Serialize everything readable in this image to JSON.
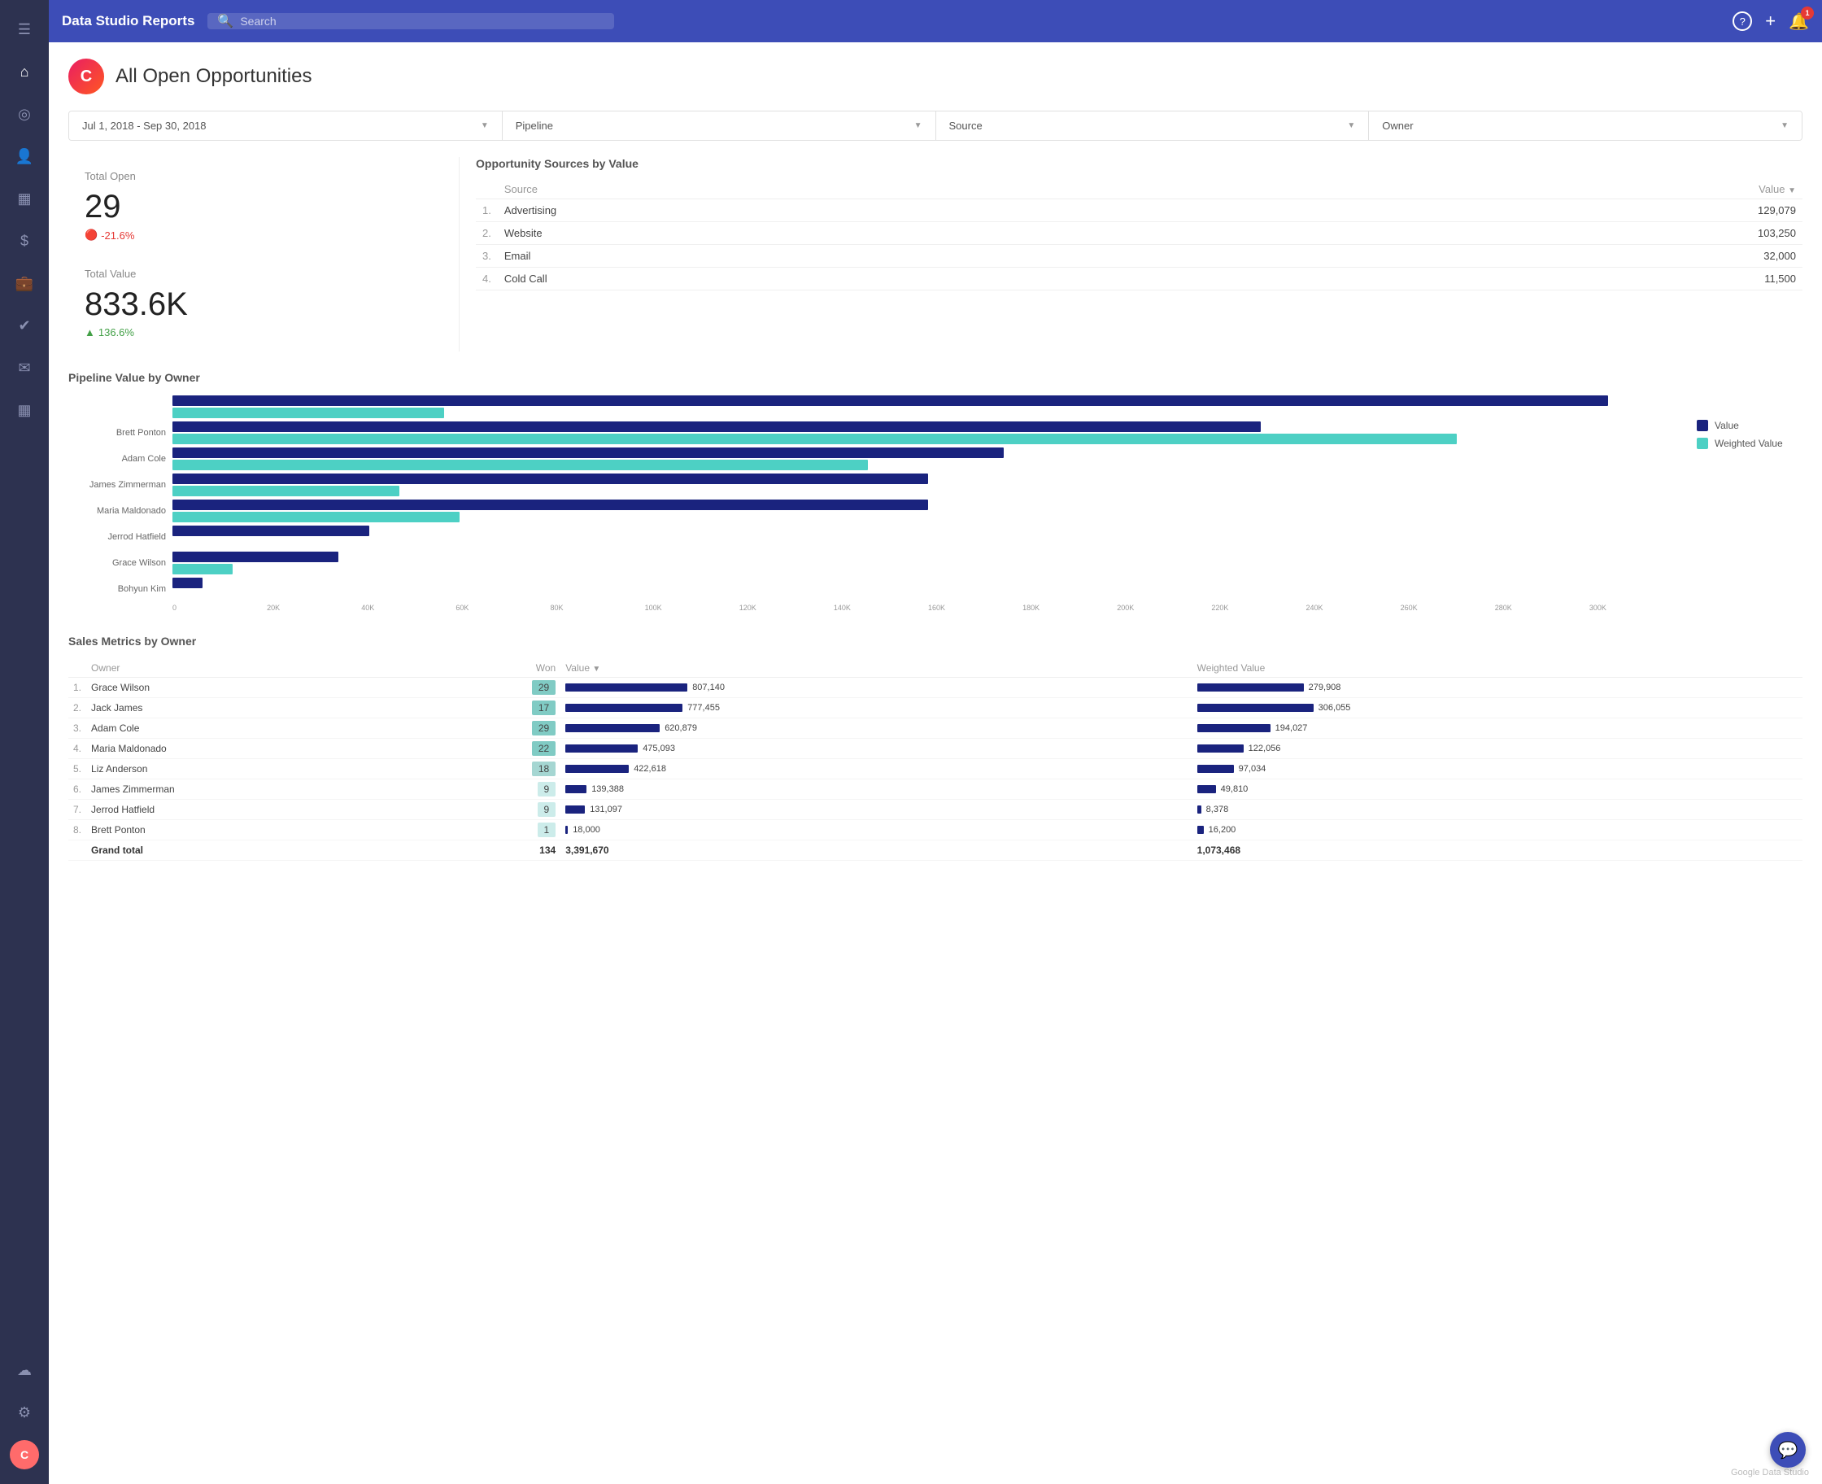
{
  "app": {
    "title": "Data Studio Reports",
    "search_placeholder": "Search"
  },
  "sidebar": {
    "icons": [
      "☰",
      "⌂",
      "◎",
      "👤",
      "▦",
      "$",
      "💼",
      "✔",
      "✉",
      "▦",
      "☁",
      "⚙"
    ]
  },
  "header": {
    "help_label": "?",
    "add_label": "+",
    "notif_count": "1"
  },
  "page": {
    "title": "All Open Opportunities",
    "logo_letter": "C"
  },
  "filters": [
    {
      "label": "Jul 1, 2018 - Sep 30, 2018"
    },
    {
      "label": "Pipeline"
    },
    {
      "label": "Source"
    },
    {
      "label": "Owner"
    }
  ],
  "total_open": {
    "label": "Total Open",
    "value": "29",
    "change": "-21.6%",
    "change_type": "negative"
  },
  "total_value": {
    "label": "Total Value",
    "value": "833.6K",
    "change": "136.6%",
    "change_type": "positive"
  },
  "opportunity_sources": {
    "title": "Opportunity Sources by Value",
    "col_source": "Source",
    "col_value": "Value",
    "rows": [
      {
        "num": "1.",
        "source": "Advertising",
        "value": "129,079"
      },
      {
        "num": "2.",
        "source": "Website",
        "value": "103,250"
      },
      {
        "num": "3.",
        "source": "Email",
        "value": "32,000"
      },
      {
        "num": "4.",
        "source": "Cold Call",
        "value": "11,500"
      }
    ]
  },
  "pipeline_chart": {
    "title": "Pipeline Value by Owner",
    "legend": [
      {
        "label": "Value",
        "color": "#1a237e"
      },
      {
        "label": "Weighted Value",
        "color": "#4dd0c4"
      }
    ],
    "rows": [
      {
        "label": "",
        "value_pct": 95,
        "weighted_pct": 18
      },
      {
        "label": "Brett Ponton",
        "value_pct": 72,
        "weighted_pct": 85
      },
      {
        "label": "Adam Cole",
        "value_pct": 55,
        "weighted_pct": 46
      },
      {
        "label": "James Zimmerman",
        "value_pct": 50,
        "weighted_pct": 15
      },
      {
        "label": "Maria Maldonado",
        "value_pct": 50,
        "weighted_pct": 19
      },
      {
        "label": "Jerrod Hatfield",
        "value_pct": 13,
        "weighted_pct": 0
      },
      {
        "label": "Grace Wilson",
        "value_pct": 11,
        "weighted_pct": 4
      },
      {
        "label": "Bohyun Kim",
        "value_pct": 2,
        "weighted_pct": 0
      }
    ],
    "x_labels": [
      "0",
      "20K",
      "40K",
      "60K",
      "80K",
      "100K",
      "120K",
      "140K",
      "160K",
      "180K",
      "200K",
      "220K",
      "240K",
      "260K",
      "280K",
      "300K"
    ]
  },
  "sales_metrics": {
    "title": "Sales Metrics by Owner",
    "col_owner": "Owner",
    "col_won": "Won",
    "col_value": "Value",
    "col_weighted": "Weighted Value",
    "rows": [
      {
        "num": "1.",
        "owner": "Grace Wilson",
        "won": 29,
        "won_level": "high",
        "value": 807140,
        "value_str": "807,140",
        "value_pct": 100,
        "weighted": 279908,
        "weighted_str": "279,908",
        "weighted_pct": 87
      },
      {
        "num": "2.",
        "owner": "Jack James",
        "won": 17,
        "won_level": "high",
        "value": 777455,
        "value_str": "777,455",
        "value_pct": 96,
        "weighted": 306055,
        "weighted_str": "306,055",
        "weighted_pct": 95
      },
      {
        "num": "3.",
        "owner": "Adam Cole",
        "won": 29,
        "won_level": "high",
        "value": 620879,
        "value_str": "620,879",
        "value_pct": 77,
        "weighted": 194027,
        "weighted_str": "194,027",
        "weighted_pct": 60
      },
      {
        "num": "4.",
        "owner": "Maria Maldonado",
        "won": 22,
        "won_level": "high",
        "value": 475093,
        "value_str": "475,093",
        "value_pct": 59,
        "weighted": 122056,
        "weighted_str": "122,056",
        "weighted_pct": 38
      },
      {
        "num": "5.",
        "owner": "Liz Anderson",
        "won": 18,
        "won_level": "medium",
        "value": 422618,
        "value_str": "422,618",
        "value_pct": 52,
        "weighted": 97034,
        "weighted_str": "97,034",
        "weighted_pct": 30
      },
      {
        "num": "6.",
        "owner": "James Zimmerman",
        "won": 9,
        "won_level": "low",
        "value": 139388,
        "value_str": "139,388",
        "value_pct": 17,
        "weighted": 49810,
        "weighted_str": "49,810",
        "weighted_pct": 15
      },
      {
        "num": "7.",
        "owner": "Jerrod Hatfield",
        "won": 9,
        "won_level": "low",
        "value": 131097,
        "value_str": "131,097",
        "value_pct": 16,
        "weighted": 8378,
        "weighted_str": "8,378",
        "weighted_pct": 3
      },
      {
        "num": "8.",
        "owner": "Brett Ponton",
        "won": 1,
        "won_level": "low",
        "value": 18000,
        "value_str": "18,000",
        "value_pct": 2,
        "weighted": 16200,
        "weighted_str": "16,200",
        "weighted_pct": 5
      }
    ],
    "grand_total": {
      "label": "Grand total",
      "won": "134",
      "value": "3,391,670",
      "weighted": "1,073,468"
    }
  },
  "footer": {
    "text": "Google Data Studio"
  },
  "chat_icon": "💬"
}
